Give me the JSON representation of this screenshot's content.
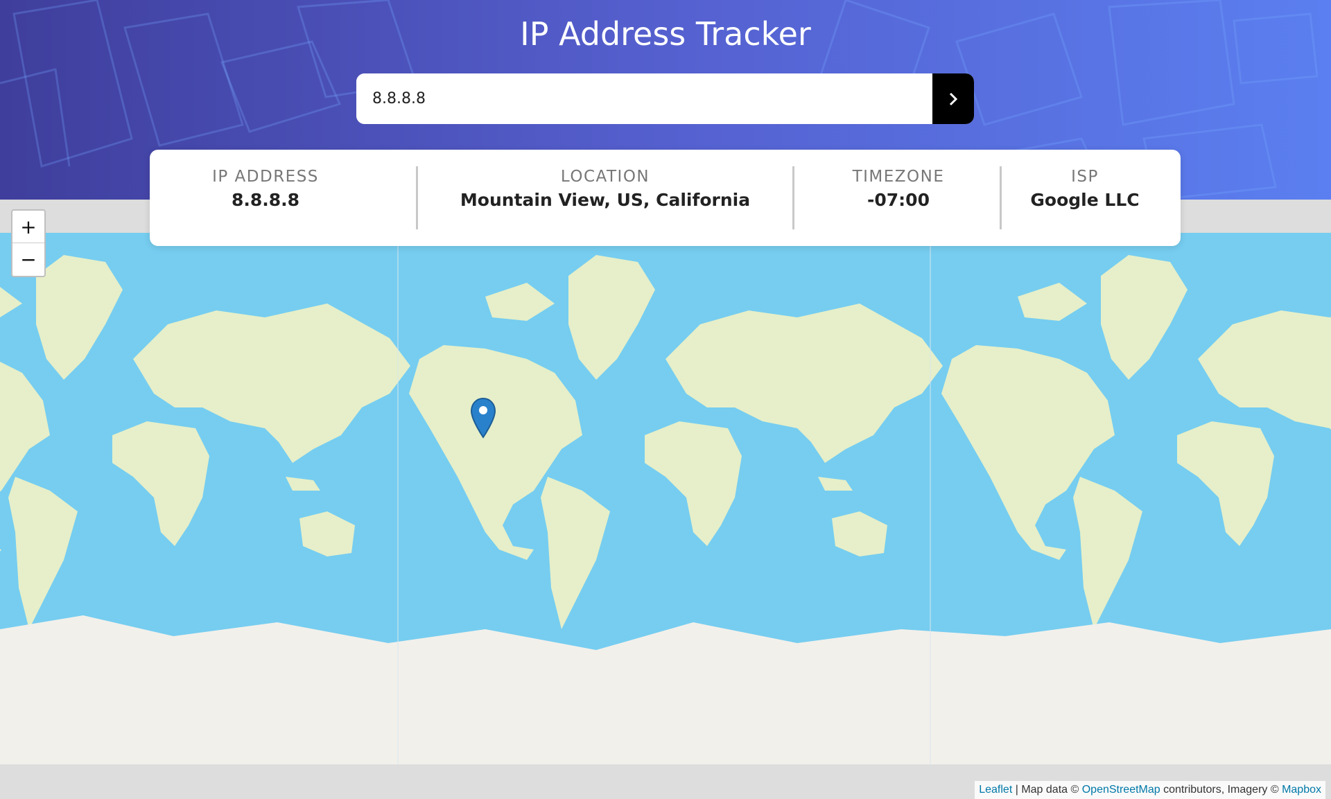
{
  "header": {
    "title": "IP Address Tracker",
    "search_value": "8.8.8.8",
    "submit_icon": "chevron-right-icon"
  },
  "info": {
    "ip": {
      "label": "IP ADDRESS",
      "value": "8.8.8.8"
    },
    "location": {
      "label": "LOCATION",
      "value": "Mountain View, US, California"
    },
    "timezone": {
      "label": "TIMEZONE",
      "value": "-07:00"
    },
    "isp": {
      "label": "ISP",
      "value": "Google LLC"
    }
  },
  "map": {
    "zoom_in": "+",
    "zoom_out": "−",
    "marker_icon": "map-pin-icon",
    "attribution": {
      "leaflet": "Leaflet",
      "sep1": " | Map data © ",
      "osm": "OpenStreetMap",
      "mid": " contributors, Imagery © ",
      "mapbox": "Mapbox"
    }
  },
  "colors": {
    "ocean": "#76cdf0",
    "land": "#e6efc9",
    "ice": "#f2f0eb",
    "header_start": "#3f3e9c",
    "header_end": "#5b7ff0",
    "marker": "#2a81cb"
  }
}
